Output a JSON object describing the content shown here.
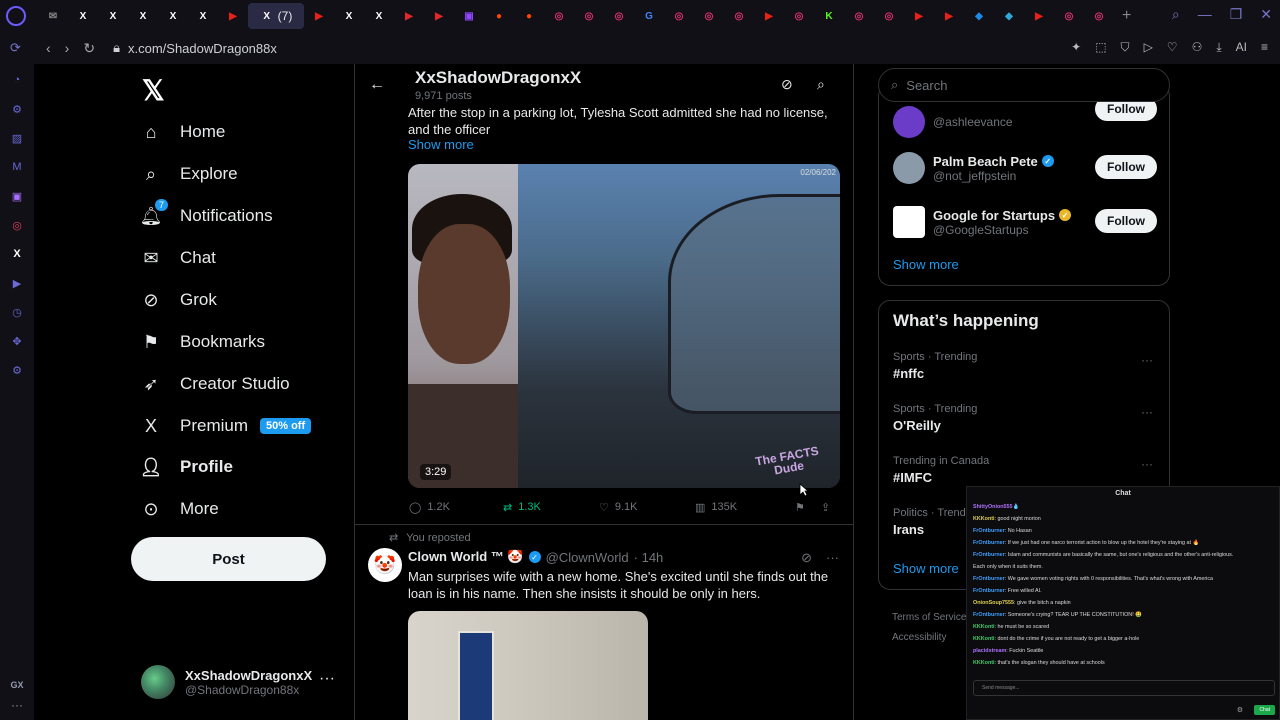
{
  "browser": {
    "url": "x.com/ShadowDragon88x",
    "active_tab_badge": "(7)",
    "ai_label": "AI",
    "gx_label": "GX"
  },
  "nav": {
    "items": [
      {
        "label": "Home",
        "icon": "home-icon"
      },
      {
        "label": "Explore",
        "icon": "search-icon"
      },
      {
        "label": "Notifications",
        "icon": "bell-icon",
        "badge": "7"
      },
      {
        "label": "Chat",
        "icon": "mail-icon"
      },
      {
        "label": "Grok",
        "icon": "grok-icon"
      },
      {
        "label": "Bookmarks",
        "icon": "bookmark-icon"
      },
      {
        "label": "Creator Studio",
        "icon": "rocket-icon"
      },
      {
        "label": "Premium",
        "icon": "x-icon",
        "promo": "50% off"
      },
      {
        "label": "Profile",
        "icon": "person-icon"
      },
      {
        "label": "More",
        "icon": "more-icon"
      }
    ],
    "post_label": "Post",
    "account": {
      "name": "XxShadowDragonxX",
      "handle": "@ShadowDragon88x"
    }
  },
  "profile_header": {
    "name": "XxShadowDragonxX",
    "posts": "9,971 posts"
  },
  "post1": {
    "text": "After the stop in a parking lot, Tylesha Scott admitted she had no license, and the officer",
    "show_more": "Show more",
    "video_date": "02/06/202",
    "duration": "3:29",
    "watermark": "The FACTS Dude",
    "replies": "1.2K",
    "reposts": "1.3K",
    "likes": "9.1K",
    "views": "135K"
  },
  "post2": {
    "repost_label": "You reposted",
    "name": "Clown World ™ 🤡",
    "handle": "@ClownWorld",
    "time": "· 14h",
    "text": "Man surprises wife with a new home. She's excited until she finds out the loan is in his name. Then she insists it should be only in hers."
  },
  "sidebar": {
    "search_placeholder": "Search",
    "who_to_follow": [
      {
        "name": "",
        "handle": "@ashleevance",
        "follow": "Follow",
        "color": "#6a3cc8"
      },
      {
        "name": "Palm Beach Pete",
        "handle": "@not_jeffpstein",
        "follow": "Follow",
        "color": "#8a9aa8"
      },
      {
        "name": "Google for Startups",
        "handle": "@GoogleStartups",
        "follow": "Follow",
        "color": "#ffffff"
      }
    ],
    "show_more": "Show more",
    "happening_title": "What’s happening",
    "trends": [
      {
        "category": "Sports · Trending",
        "topic": "#nffc"
      },
      {
        "category": "Sports · Trending",
        "topic": "O'Reilly"
      },
      {
        "category": "Trending in Canada",
        "topic": "#IMFC"
      },
      {
        "category": "Politics · Trend",
        "topic": "Irans"
      }
    ],
    "happening_show_more": "Show more",
    "footer_links": [
      "Terms of Service",
      "Accessibility"
    ]
  },
  "chat": {
    "title": "Chat",
    "messages": [
      {
        "user": "ShittyOnion555",
        "text": "💧",
        "color": "p"
      },
      {
        "user": "KKKonti",
        "text": ": good night morion",
        "color": "y"
      },
      {
        "user": "FrOntburner",
        "text": ": No Hasan",
        "color": "b"
      },
      {
        "user": "FrOntburner",
        "text": ": If we just had one narco terrorist action to blow up the hotel they're staying at 🔥",
        "color": "b"
      },
      {
        "user": "FrOntburner",
        "text": ": Islam and communists are basically the same, but one's religious and the other's anti-religious.",
        "color": "b"
      },
      {
        "user": "",
        "text": "Each only when it suits them.",
        "color": "b"
      },
      {
        "user": "FrOntburner",
        "text": ": We gave women voting rights with 0 responsibilities. That's what's wrong with America",
        "color": "b"
      },
      {
        "user": "FrOntburner",
        "text": ": Free willed AI.",
        "color": "b"
      },
      {
        "user": "OnionSoup7555",
        "text": ": give the bitch a napkin",
        "color": "y"
      },
      {
        "user": "FrOntburner",
        "text": ": Someone's crying? TEAR UP THE CONSTITUTION! 🤮",
        "color": "b"
      },
      {
        "user": "KKKonti",
        "text": ": he must be so scared",
        "color": "g"
      },
      {
        "user": "KKKonti",
        "text": ": dont do the crime if you are not ready to get a bigger a-hole",
        "color": "g"
      },
      {
        "user": "placidstream",
        "text": ": Fuckin Seattle",
        "color": "p"
      },
      {
        "user": "KKKonti",
        "text": ": that's the slogan they should have at schools",
        "color": "g"
      }
    ],
    "input_placeholder": "Send message...",
    "send_label": "Chat"
  },
  "colors": {
    "accent": "#1d9bf0",
    "repost_green": "#00ba7c",
    "bg": "#000000",
    "border": "#2f3336"
  }
}
